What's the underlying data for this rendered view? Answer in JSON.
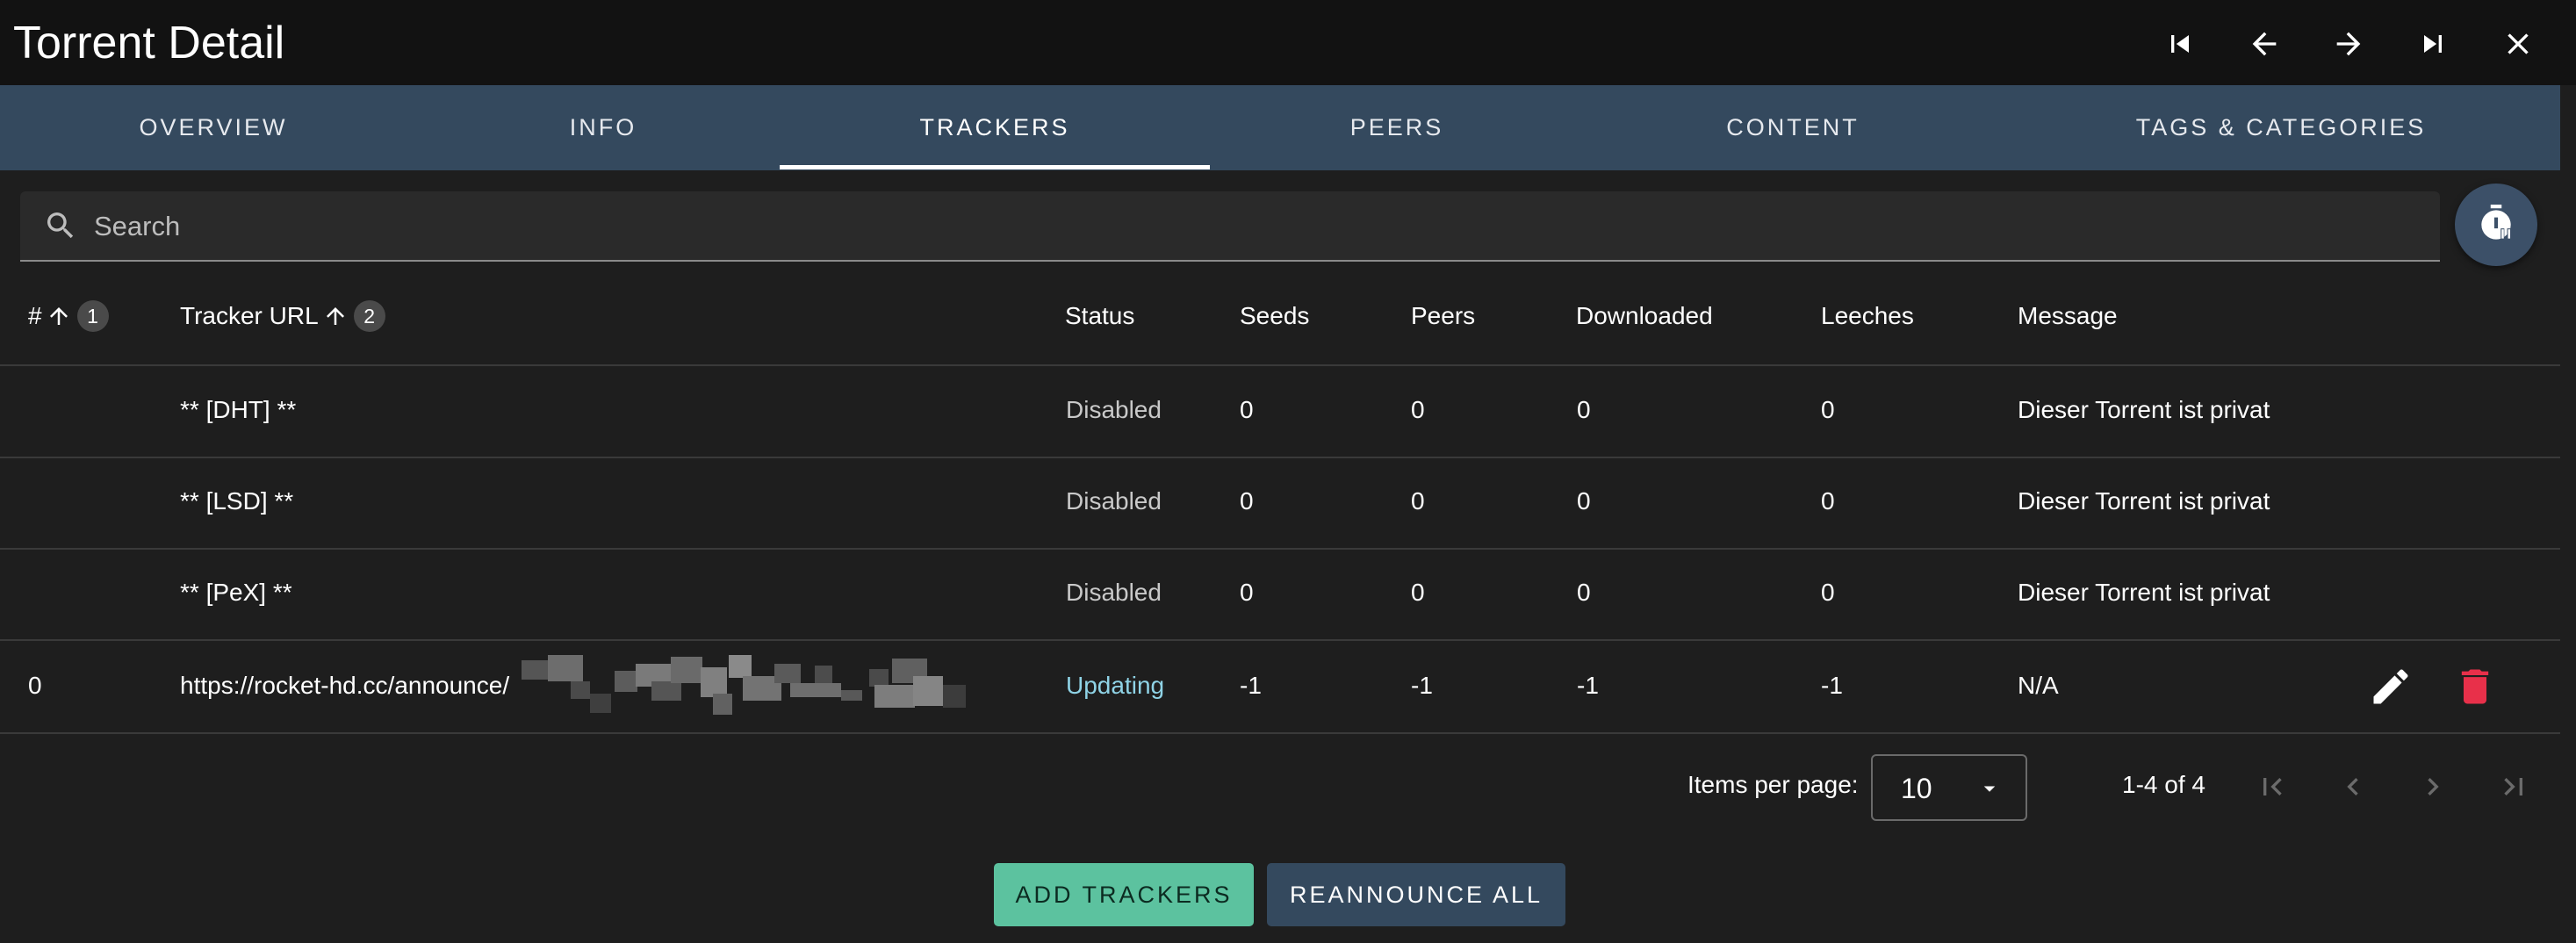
{
  "window": {
    "title": "Torrent Detail",
    "controls": [
      "first-page-icon",
      "arrow-left-icon",
      "arrow-right-icon",
      "last-page-icon",
      "close-icon"
    ]
  },
  "tabs": [
    {
      "label": "OVERVIEW"
    },
    {
      "label": "INFO"
    },
    {
      "label": "TRACKERS",
      "active": true
    },
    {
      "label": "PEERS"
    },
    {
      "label": "CONTENT"
    },
    {
      "label": "TAGS & CATEGORIES"
    }
  ],
  "search": {
    "placeholder": "Search",
    "value": ""
  },
  "table": {
    "headers": {
      "index": "#",
      "index_sort_badge": "1",
      "url": "Tracker URL",
      "url_sort_badge": "2",
      "status": "Status",
      "seeds": "Seeds",
      "peers": "Peers",
      "downloaded": "Downloaded",
      "leeches": "Leeches",
      "message": "Message"
    },
    "rows": [
      {
        "index": "",
        "url": "** [DHT] **",
        "status": "Disabled",
        "seeds": "0",
        "peers": "0",
        "downloaded": "0",
        "leeches": "0",
        "message": "Dieser Torrent ist privat"
      },
      {
        "index": "",
        "url": "** [LSD] **",
        "status": "Disabled",
        "seeds": "0",
        "peers": "0",
        "downloaded": "0",
        "leeches": "0",
        "message": "Dieser Torrent ist privat"
      },
      {
        "index": "",
        "url": "** [PeX] **",
        "status": "Disabled",
        "seeds": "0",
        "peers": "0",
        "downloaded": "0",
        "leeches": "0",
        "message": "Dieser Torrent ist privat"
      },
      {
        "index": "0",
        "url": "https://rocket-hd.cc/announce/",
        "status": "Updating",
        "seeds": "-1",
        "peers": "-1",
        "downloaded": "-1",
        "leeches": "-1",
        "message": "N/A"
      }
    ]
  },
  "pagination": {
    "items_per_page_label": "Items per page:",
    "items_per_page": "10",
    "range": "1-4 of 4"
  },
  "buttons": {
    "add_trackers": "ADD TRACKERS",
    "reannounce_all": "REANNOUNCE ALL"
  },
  "colors": {
    "tab_bar": "#34495e",
    "accent_add": "#5cc29f",
    "delete": "#e8304a",
    "status_updating": "#8fd3e6"
  }
}
